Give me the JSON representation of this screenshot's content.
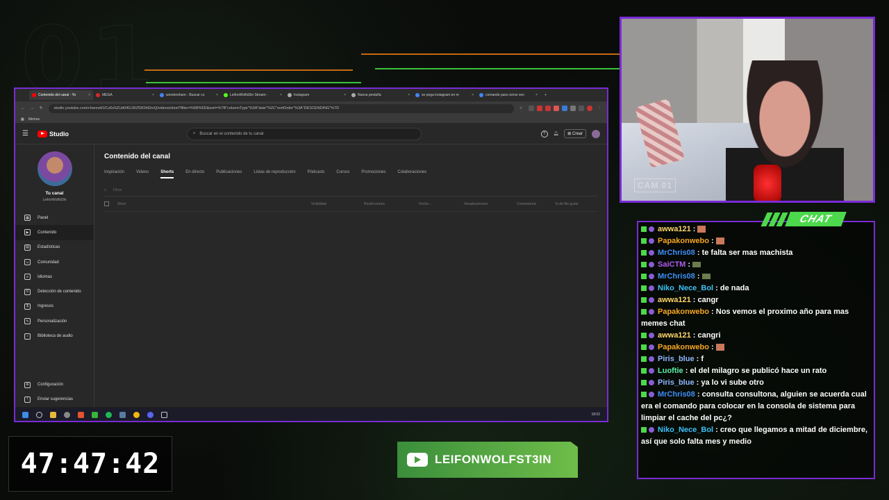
{
  "colors": {
    "accent": "#7a2bd6",
    "chat_green": "#4cd94c"
  },
  "browser": {
    "tabs": [
      {
        "label": "Contenido del canal - Yo",
        "color": "#ff0000",
        "active": true
      },
      {
        "label": "MEGA",
        "color": "#d9272e"
      },
      {
        "label": "wondershare - Buscar co",
        "color": "#4285f4"
      },
      {
        "label": "LeifonWolfst3in Stream -",
        "color": "#53fc18"
      },
      {
        "label": "Instagram",
        "color": "#aaaaaa"
      },
      {
        "label": "Nueva pestaña",
        "color": "#aaaaaa"
      },
      {
        "label": "se pega instagram en m",
        "color": "#4285f4"
      },
      {
        "label": "comando para cerrar ven",
        "color": "#4285f4"
      }
    ],
    "url": "studio.youtube.com/channel/UCz6xSZUd04G1RZ59OhEhvQ/videos/short?filter=%5B%5D&sort=%7B\"columnType\"%3A\"date\"%2C\"sortOrder\"%3A\"DESCENDING\"%7D",
    "bookmark": "Memes"
  },
  "studio": {
    "logo_text": "Studio",
    "search_placeholder": "Buscar en el contenido de tu canal",
    "create_label": "Crear",
    "channel_name": "Tu canal",
    "channel_handle": "LeifonWolfst3in",
    "nav": [
      {
        "label": "Panel",
        "icon": "dashboard-icon",
        "glyph": "▦"
      },
      {
        "label": "Contenido",
        "icon": "content-icon",
        "glyph": "▶",
        "active": true
      },
      {
        "label": "Estadísticas",
        "icon": "analytics-icon",
        "glyph": "▤"
      },
      {
        "label": "Comunidad",
        "icon": "community-icon",
        "glyph": "☺"
      },
      {
        "label": "Idiomas",
        "icon": "subtitles-icon",
        "glyph": "≡"
      },
      {
        "label": "Detección de contenido",
        "icon": "copyright-icon",
        "glyph": "©"
      },
      {
        "label": "Ingresos",
        "icon": "earn-icon",
        "glyph": "$"
      },
      {
        "label": "Personalización",
        "icon": "customization-icon",
        "glyph": "✎"
      },
      {
        "label": "Biblioteca de audio",
        "icon": "audio-library-icon",
        "glyph": "♪"
      }
    ],
    "nav_bottom": [
      {
        "label": "Configuración",
        "icon": "settings-icon",
        "glyph": "⚙"
      },
      {
        "label": "Enviar sugerencias",
        "icon": "feedback-icon",
        "glyph": "!"
      }
    ],
    "page_title": "Contenido del canal",
    "tabs": [
      "Inspiración",
      "Videos",
      "Shorts",
      "En directo",
      "Publicaciones",
      "Listas de reproducción",
      "Pódcasts",
      "Cursos",
      "Promociones",
      "Colaboraciones"
    ],
    "active_tab": "Shorts",
    "filter_placeholder": "Filtrar",
    "columns": [
      "Short",
      "Visibilidad",
      "Restricciones",
      "Fecha ↓",
      "Visualizaciones",
      "Comentarios",
      "% de Me gusta"
    ]
  },
  "taskbar": {
    "time": "18:02"
  },
  "camera": {
    "tag": "CAM 01"
  },
  "chat": {
    "label": "CHAT",
    "messages": [
      {
        "user": "awwa121",
        "color": "#ffd76b",
        "text": "",
        "emote": true
      },
      {
        "user": "Papakonwebo",
        "color": "#f5a623",
        "text": "",
        "emote": true
      },
      {
        "user": "MrChris08",
        "color": "#3d8ff5",
        "text": "te falta ser mas machista"
      },
      {
        "user": "SaiCTM",
        "color": "#b05cf0",
        "text": "",
        "emote2": true
      },
      {
        "user": "MrChris08",
        "color": "#3d8ff5",
        "text": "",
        "emote2": true
      },
      {
        "user": "Niko_Nece_Bol",
        "color": "#3dc0f5",
        "text": "de nada"
      },
      {
        "user": "awwa121",
        "color": "#ffd76b",
        "text": "cangr"
      },
      {
        "user": "Papakonwebo",
        "color": "#f5a623",
        "text": "Nos vemos el proximo año para mas memes chat"
      },
      {
        "user": "awwa121",
        "color": "#ffd76b",
        "text": "cangri"
      },
      {
        "user": "Papakonwebo",
        "color": "#f5a623",
        "text": "",
        "emote": true
      },
      {
        "user": "Piris_blue",
        "color": "#8fb7ff",
        "text": "f"
      },
      {
        "user": "Luoftie",
        "color": "#5cf0a8",
        "text": "el del milagro se publicó hace un rato"
      },
      {
        "user": "Piris_blue",
        "color": "#8fb7ff",
        "text": "ya lo vi sube otro"
      },
      {
        "user": "MrChris08",
        "color": "#3d8ff5",
        "text": "consulta consultona, alguien se acuerda cual era el comando para colocar en la consola de sistema para limpiar el cache del pc¿?"
      },
      {
        "user": "Niko_Nece_Bol",
        "color": "#3dc0f5",
        "text": "creo que llegamos a mitad de diciembre, así que solo falta mes y medio"
      }
    ]
  },
  "timer": "47:47:42",
  "banner": {
    "channel": "LEIFONWOLFST3IN"
  }
}
